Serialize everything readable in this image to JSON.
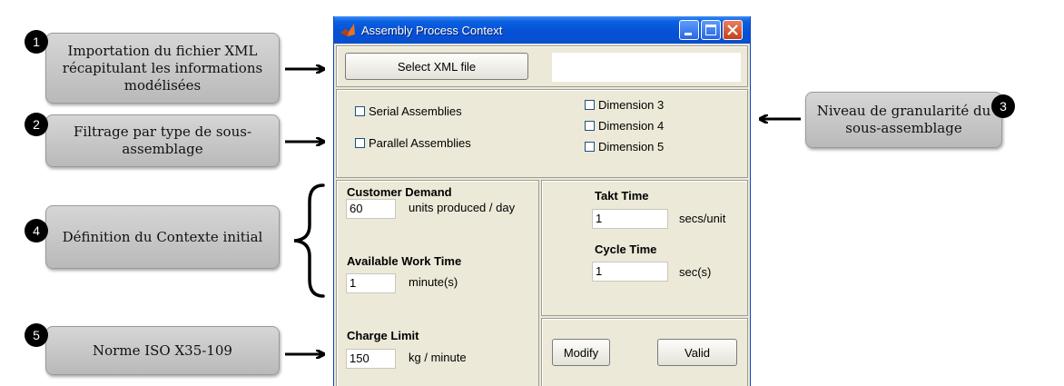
{
  "callouts": [
    {
      "number": "1",
      "text": "Importation du fichier XML récapitulant les informations modélisées"
    },
    {
      "number": "2",
      "text": "Filtrage par type de sous-assemblage"
    },
    {
      "number": "3",
      "text": "Niveau de granularité du sous-assemblage"
    },
    {
      "number": "4",
      "text": "Définition du Contexte initial"
    },
    {
      "number": "5",
      "text": "Norme ISO X35-109"
    }
  ],
  "window": {
    "title": "Assembly Process Context",
    "app_icon": "matlab-icon",
    "controls": [
      "minimize-icon",
      "maximize-icon",
      "close-icon"
    ]
  },
  "file": {
    "select_label": "Select XML file",
    "path_value": ""
  },
  "filters": {
    "serial": "Serial Assemblies",
    "parallel": "Parallel Assemblies",
    "dimensions": [
      "Dimension 3",
      "Dimension 4",
      "Dimension 5"
    ]
  },
  "context": {
    "demand_label": "Customer Demand",
    "demand_value": "60",
    "demand_unit": "units produced / day",
    "work_time_label": "Available Work Time",
    "work_time_value": "1",
    "work_time_unit": "minute(s)",
    "charge_label": "Charge Limit",
    "charge_value": "150",
    "charge_unit": "kg / minute"
  },
  "results": {
    "takt_label": "Takt Time",
    "takt_value": "1",
    "takt_unit": "secs/unit",
    "cycle_label": "Cycle Time",
    "cycle_value": "1",
    "cycle_unit": "sec(s)"
  },
  "actions": {
    "modify": "Modify",
    "valid": "Valid"
  }
}
